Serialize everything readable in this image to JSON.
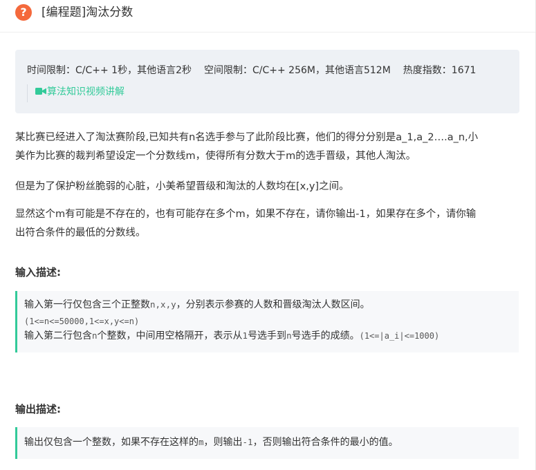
{
  "header": {
    "icon": "question-circle-icon",
    "title": "[编程题]淘汰分数"
  },
  "info": {
    "time_limit": "时间限制：C/C++ 1秒，其他语言2秒",
    "space_limit": "空间限制：C/C++ 256M，其他语言512M",
    "heat": "热度指数：1671",
    "video_link": "算法知识视频讲解",
    "video_icon": "video-camera-icon",
    "accent": "#32ca99"
  },
  "description": {
    "p1_line1": "某比赛已经进入了淘汰赛阶段,已知共有n名选手参与了此阶段比赛，他们的得分分别是a_1,a_2….a_n,小",
    "p1_line2": "美作为比赛的裁判希望设定一个分数线m，使得所有分数大于m的选手晋级，其他人淘汰。",
    "p2": "但是为了保护粉丝脆弱的心脏，小美希望晋级和淘汰的人数均在[x,y]之间。",
    "p3_line1": "显然这个m有可能是不存在的，也有可能存在多个m，如果不存在，请你输出-1，如果存在多个，请你输",
    "p3_line2": "出符合条件的最低的分数线。"
  },
  "input": {
    "title": "输入描述:",
    "l1_text_a": "输入第一行仅包含三个正整数",
    "l1_code": "n,x,y",
    "l1_text_b": "，分别表示参赛的人数和晋级淘汰人数区间。",
    "l2_code": "(1<=n<=50000,1<=x,y<=n)",
    "l3_text_a": "输入第二行包含",
    "l3_code_a": "n",
    "l3_text_b": "个整数，中间用空格隔开，表示从",
    "l3_code_b": "1",
    "l3_text_c": "号选手到",
    "l3_code_c": "n",
    "l3_text_d": "号选手的成绩。",
    "l3_code_d": "(1<=|a_i|<=1000)"
  },
  "output": {
    "title": "输出描述:",
    "text_a": "输出仅包含一个整数，如果不存在这样的",
    "code_a": "m",
    "text_b": "，则输出",
    "code_b": "-1",
    "text_c": "，否则输出符合条件的最小的值。"
  }
}
